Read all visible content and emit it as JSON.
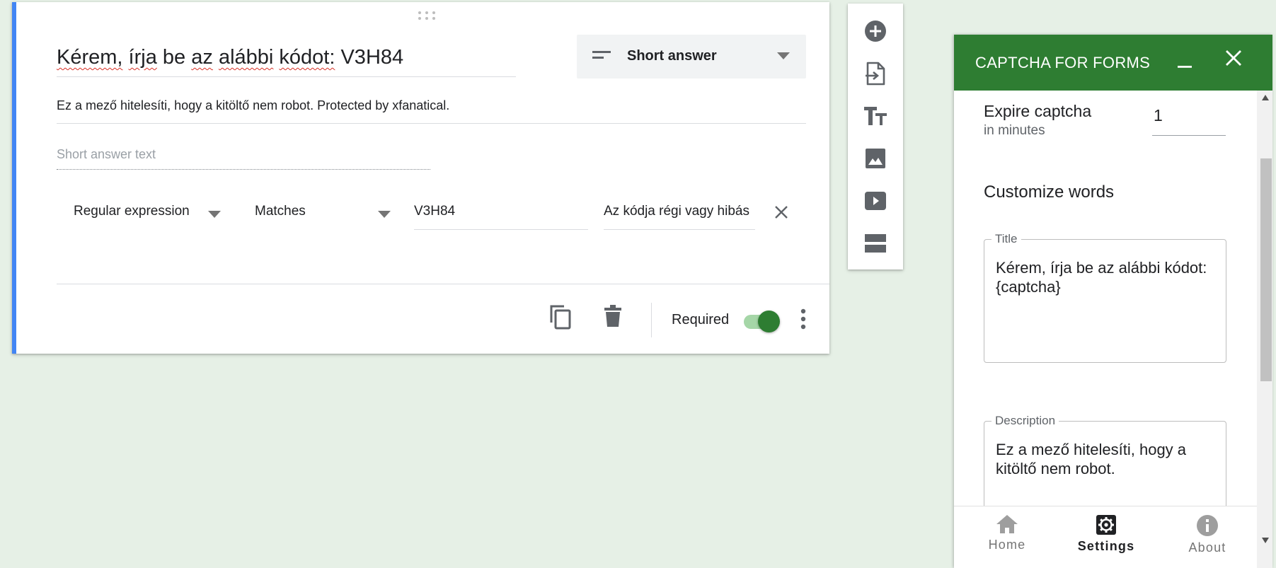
{
  "question": {
    "title_parts": {
      "w1": "Kérem,",
      "w2": "írja",
      "w3": "be",
      "w4": "az",
      "w5": "alábbi",
      "w6": "kódot:",
      "w7": "V3H84"
    },
    "type_label": "Short answer",
    "description": "Ez a mező hitelesíti, hogy a kitöltő nem robot. Protected by xfanatical.",
    "answer_placeholder": "Short answer text",
    "validation": {
      "type": "Regular expression",
      "condition": "Matches",
      "pattern": "V3H84",
      "error_text": "Az kódja régi vagy hibás"
    },
    "required_label": "Required",
    "required": true
  },
  "toolbar": {
    "buttons": [
      "add-question-icon",
      "import-questions-icon",
      "add-title-icon",
      "add-image-icon",
      "add-video-icon",
      "add-section-icon"
    ]
  },
  "panel": {
    "title": "CAPTCHA FOR FORMS",
    "expire_label": "Expire captcha",
    "expire_sub": "in minutes",
    "expire_value": "1",
    "customize_label": "Customize words",
    "title_field": {
      "legend": "Title",
      "value": "Kérem, írja be az alábbi kódot: {captcha}"
    },
    "description_field": {
      "legend": "Description",
      "value": "Ez a mező hitelesíti, hogy a kitöltő nem robot."
    },
    "nav": {
      "home": "Home",
      "settings": "Settings",
      "about": "About",
      "active": "settings"
    }
  },
  "colors": {
    "accent_blue": "#4285f4",
    "brand_green": "#2e7d32",
    "toggle_track": "#a5d6a7"
  }
}
